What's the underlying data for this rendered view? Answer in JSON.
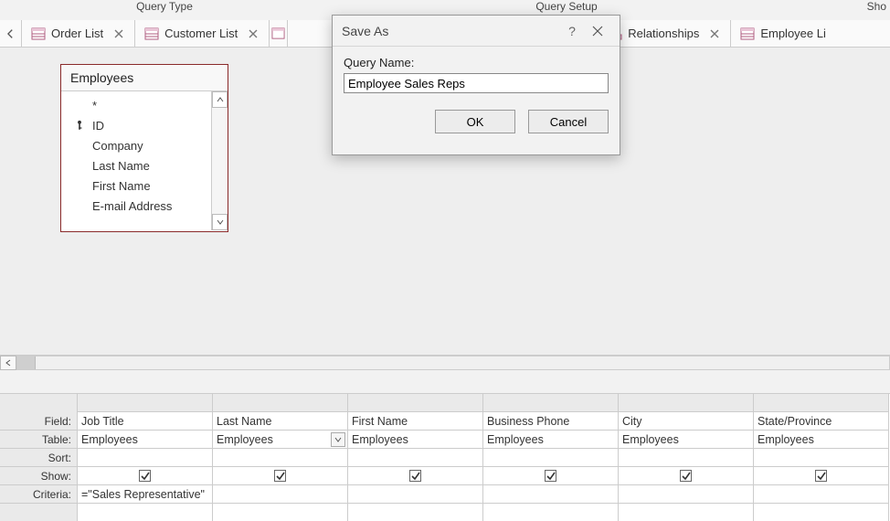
{
  "ribbon": {
    "group1": "Query Type",
    "group2": "Query Setup",
    "group3": "Sho"
  },
  "tabs": [
    {
      "label": "Order List",
      "icon": "datasheet"
    },
    {
      "label": "Customer List",
      "icon": "datasheet"
    },
    {
      "label": "",
      "icon": "datasheet"
    },
    {
      "label": "Relationships",
      "icon": "relationships"
    },
    {
      "label": "Employee Li",
      "icon": "datasheet"
    }
  ],
  "table_box": {
    "title": "Employees",
    "fields": [
      "*",
      "ID",
      "Company",
      "Last Name",
      "First Name",
      "E-mail Address"
    ],
    "key_index": 1
  },
  "grid": {
    "row_labels": [
      "Field:",
      "Table:",
      "Sort:",
      "Show:",
      "Criteria:"
    ],
    "columns": [
      {
        "field": "Job Title",
        "table": "Employees",
        "sort": "",
        "show": true,
        "criteria": "=\"Sales Representative\"",
        "selected": false
      },
      {
        "field": "Last Name",
        "table": "Employees",
        "sort": "",
        "show": true,
        "criteria": "",
        "selected": true
      },
      {
        "field": "First Name",
        "table": "Employees",
        "sort": "",
        "show": true,
        "criteria": "",
        "selected": false
      },
      {
        "field": "Business Phone",
        "table": "Employees",
        "sort": "",
        "show": true,
        "criteria": "",
        "selected": false
      },
      {
        "field": "City",
        "table": "Employees",
        "sort": "",
        "show": true,
        "criteria": "",
        "selected": false
      },
      {
        "field": "State/Province",
        "table": "Employees",
        "sort": "",
        "show": true,
        "criteria": "",
        "selected": false
      }
    ]
  },
  "dialog": {
    "title": "Save As",
    "label": "Query Name:",
    "value": "Employee Sales Reps",
    "ok": "OK",
    "cancel": "Cancel"
  }
}
